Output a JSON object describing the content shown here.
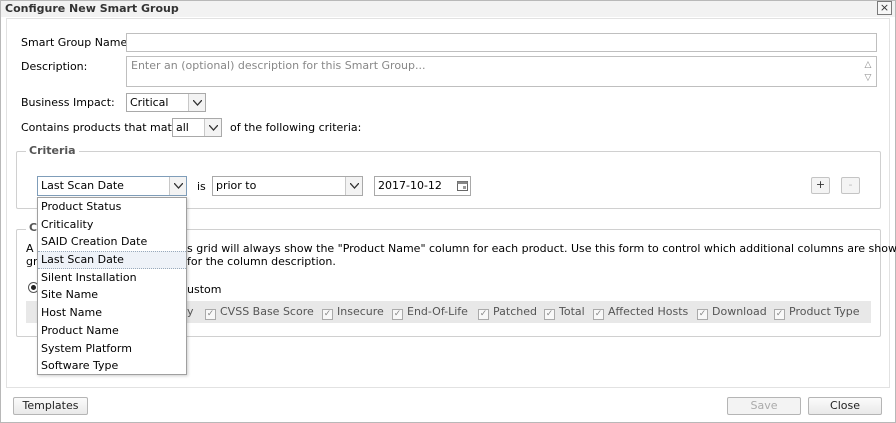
{
  "dialog": {
    "title": "Configure New Smart Group",
    "close_glyph": "×"
  },
  "form": {
    "name_label": "Smart Group Name:",
    "name_value": "",
    "description_label": "Description:",
    "description_placeholder": "Enter an (optional) description for this Smart Group...",
    "business_impact_label": "Business Impact:",
    "business_impact_value": "Critical",
    "match_prefix": "Contains products that match",
    "match_value": "all",
    "match_suffix": "of the following criteria:"
  },
  "criteria": {
    "legend": "Criteria",
    "field_value": "Last Scan Date",
    "operator_text": "is",
    "condition_value": "prior to",
    "date_value": "2017-10-12",
    "add_label": "+",
    "remove_label": "-",
    "dropdown_options": [
      "Product Status",
      "Criticality",
      "SAID Creation Date",
      "Last Scan Date",
      "Silent Installation",
      "Site Name",
      "Host Name",
      "Product Name",
      "System Platform",
      "Software Type"
    ],
    "selected_option": "Last Scan Date"
  },
  "columns": {
    "legend_partial": "C",
    "desc_line1_left": "A",
    "desc_line1_right": "s grid will always show the \"Product Name\" column for each product. Use this form to control which additional columns are shown in the",
    "desc_line2_left": "gr",
    "desc_line2_right": "for the column description.",
    "radio_partial_label": "ustom",
    "items": [
      {
        "label": "y",
        "checked": true
      },
      {
        "label": "CVSS Base Score",
        "checked": true
      },
      {
        "label": "Insecure",
        "checked": true
      },
      {
        "label": "End-Of-Life",
        "checked": true
      },
      {
        "label": "Patched",
        "checked": true
      },
      {
        "label": "Total",
        "checked": true
      },
      {
        "label": "Affected Hosts",
        "checked": true
      },
      {
        "label": "Download",
        "checked": true
      },
      {
        "label": "Product Type",
        "checked": true
      }
    ]
  },
  "footer": {
    "templates_label": "Templates",
    "save_label": "Save",
    "close_label": "Close"
  },
  "icons": {
    "dropdown_arrow": "chevron-down-icon",
    "calendar": "calendar-icon",
    "checkmark": "checkmark-icon"
  }
}
